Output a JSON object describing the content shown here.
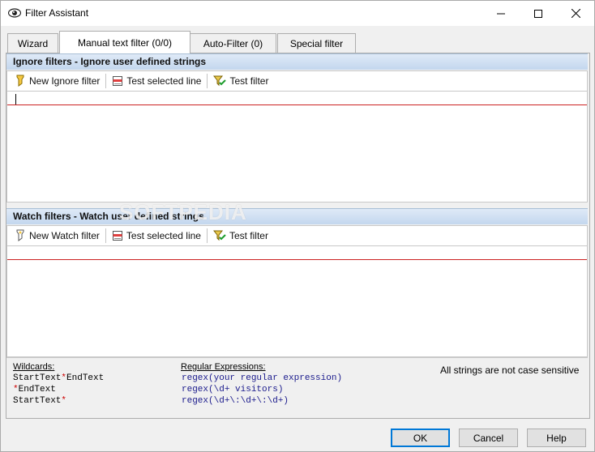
{
  "window": {
    "title": "Filter Assistant",
    "icon": "eye-icon"
  },
  "tabs": [
    {
      "label": "Wizard",
      "active": false
    },
    {
      "label": "Manual text filter  (0/0)",
      "active": true
    },
    {
      "label": "Auto-Filter  (0)",
      "active": false
    },
    {
      "label": "Special filter",
      "active": false
    }
  ],
  "ignore": {
    "header": "Ignore filters - Ignore user defined strings",
    "toolbar": {
      "new_label": "New Ignore filter",
      "test_line_label": "Test selected line",
      "test_filter_label": "Test filter"
    }
  },
  "watch": {
    "header": "Watch filters - Watch user defined strings",
    "toolbar": {
      "new_label": "New Watch filter",
      "test_line_label": "Test selected line",
      "test_filter_label": "Test filter"
    }
  },
  "help": {
    "wildcards_title": "Wildcards:",
    "wildcards": [
      {
        "prefix": "StartText",
        "star": "*",
        "suffix": "EndText"
      },
      {
        "prefix": "",
        "star": "*",
        "suffix": "EndText"
      },
      {
        "prefix": "StartText",
        "star": "*",
        "suffix": ""
      }
    ],
    "regex_title": "Regular Expressions:",
    "regex": [
      {
        "fn": "regex",
        "arg": "(your regular expression)"
      },
      {
        "fn": "regex",
        "arg": "(\\d+ visitors)"
      },
      {
        "fn": "regex",
        "arg": "(\\d+\\:\\d+\\:\\d+)"
      }
    ],
    "note": "All strings are not case sensitive"
  },
  "buttons": {
    "ok": "OK",
    "cancel": "Cancel",
    "help": "Help"
  },
  "watermark": "SOFTPEDIA",
  "colors": {
    "filter_line": "#cc2222",
    "wildcard_star": "#cc0000",
    "regex_text": "#1a1a8c",
    "default_button_border": "#0078d7"
  }
}
